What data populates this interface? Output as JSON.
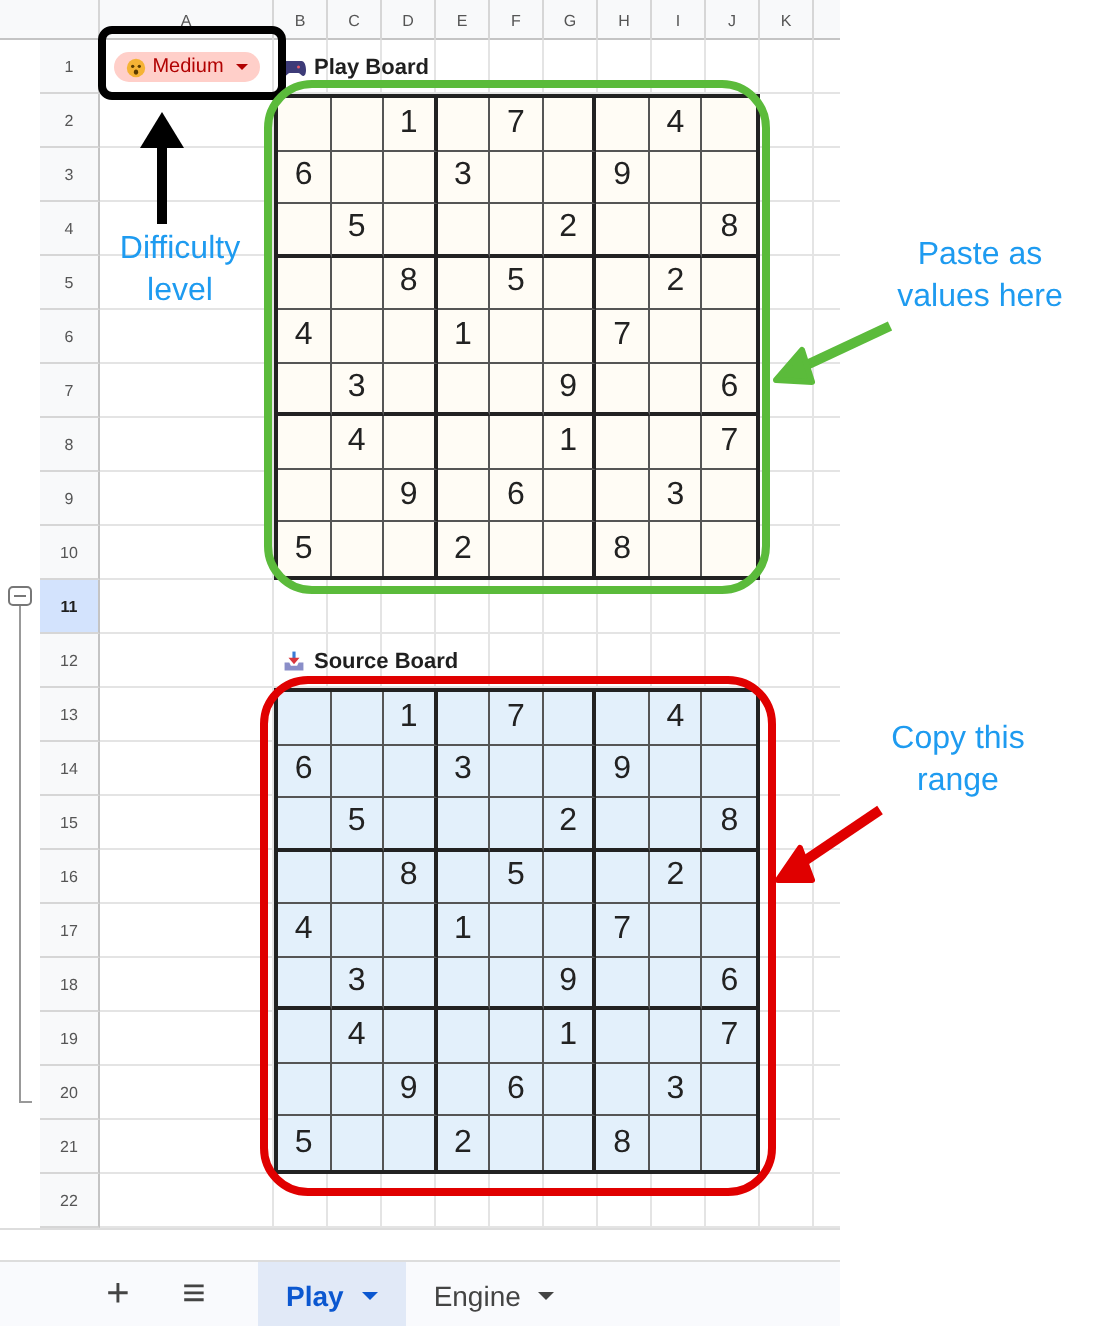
{
  "column_headers": [
    "A",
    "B",
    "C",
    "D",
    "E",
    "F",
    "G",
    "H",
    "I",
    "J",
    "K"
  ],
  "row_headers": [
    {
      "label": "1",
      "selected": false
    },
    {
      "label": "2",
      "selected": false
    },
    {
      "label": "3",
      "selected": false
    },
    {
      "label": "4",
      "selected": false
    },
    {
      "label": "5",
      "selected": false
    },
    {
      "label": "6",
      "selected": false
    },
    {
      "label": "7",
      "selected": false
    },
    {
      "label": "8",
      "selected": false
    },
    {
      "label": "9",
      "selected": false
    },
    {
      "label": "10",
      "selected": false
    },
    {
      "label": "11",
      "selected": true
    },
    {
      "label": "12",
      "selected": false
    },
    {
      "label": "13",
      "selected": false
    },
    {
      "label": "14",
      "selected": false
    },
    {
      "label": "15",
      "selected": false
    },
    {
      "label": "16",
      "selected": false
    },
    {
      "label": "17",
      "selected": false
    },
    {
      "label": "18",
      "selected": false
    },
    {
      "label": "19",
      "selected": false
    },
    {
      "label": "20",
      "selected": false
    },
    {
      "label": "21",
      "selected": false
    },
    {
      "label": "22",
      "selected": false
    }
  ],
  "difficulty": {
    "value": "Medium"
  },
  "play_board": {
    "title": "Play Board",
    "cells": [
      [
        "",
        "",
        "1",
        "",
        "7",
        "",
        "",
        "4",
        ""
      ],
      [
        "6",
        "",
        "",
        "3",
        "",
        "",
        "9",
        "",
        ""
      ],
      [
        "",
        "5",
        "",
        "",
        "",
        "2",
        "",
        "",
        "8"
      ],
      [
        "",
        "",
        "8",
        "",
        "5",
        "",
        "",
        "2",
        ""
      ],
      [
        "4",
        "",
        "",
        "1",
        "",
        "",
        "7",
        "",
        ""
      ],
      [
        "",
        "3",
        "",
        "",
        "",
        "9",
        "",
        "",
        "6"
      ],
      [
        "",
        "4",
        "",
        "",
        "",
        "1",
        "",
        "",
        "7"
      ],
      [
        "",
        "",
        "9",
        "",
        "6",
        "",
        "",
        "3",
        ""
      ],
      [
        "5",
        "",
        "",
        "2",
        "",
        "",
        "8",
        "",
        ""
      ]
    ]
  },
  "source_board": {
    "title": "Source Board",
    "cells": [
      [
        "",
        "",
        "1",
        "",
        "7",
        "",
        "",
        "4",
        ""
      ],
      [
        "6",
        "",
        "",
        "3",
        "",
        "",
        "9",
        "",
        ""
      ],
      [
        "",
        "5",
        "",
        "",
        "",
        "2",
        "",
        "",
        "8"
      ],
      [
        "",
        "",
        "8",
        "",
        "5",
        "",
        "",
        "2",
        ""
      ],
      [
        "4",
        "",
        "",
        "1",
        "",
        "",
        "7",
        "",
        ""
      ],
      [
        "",
        "3",
        "",
        "",
        "",
        "9",
        "",
        "",
        "6"
      ],
      [
        "",
        "4",
        "",
        "",
        "",
        "1",
        "",
        "",
        "7"
      ],
      [
        "",
        "",
        "9",
        "",
        "6",
        "",
        "",
        "3",
        ""
      ],
      [
        "5",
        "",
        "",
        "2",
        "",
        "",
        "8",
        "",
        ""
      ]
    ]
  },
  "annotations": {
    "difficulty_label": "Difficulty level",
    "paste_label": "Paste as values here",
    "copy_label": "Copy this range"
  },
  "tab_bar": {
    "add": "+",
    "menu": "≡"
  },
  "sheet_tabs": [
    {
      "label": "Play",
      "selected": true
    },
    {
      "label": "Engine",
      "selected": false
    }
  ]
}
